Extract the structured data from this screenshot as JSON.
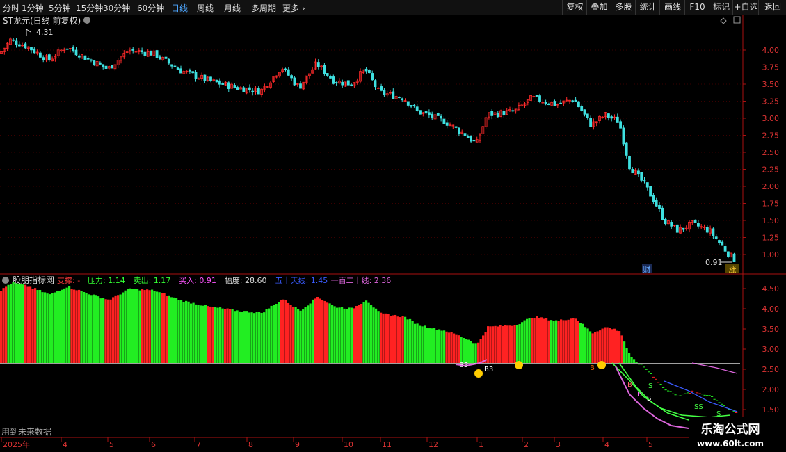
{
  "toolbar": {
    "periods": [
      "分时",
      "1分钟",
      "5分钟",
      "15分钟",
      "30分钟",
      "60分钟",
      "日线",
      "周线",
      "月线",
      "多周期",
      "更多"
    ],
    "active_period": "日线",
    "right_buttons": [
      "复权",
      "叠加",
      "多股",
      "统计",
      "画线",
      "F10",
      "标记",
      "+自选",
      "返回"
    ]
  },
  "main_panel": {
    "title": "ST龙元(日线 前复权)",
    "max_label": "4.31",
    "min_label": "0.91",
    "badge_cai": "财",
    "badge_zhang": "涨",
    "y_ticks": [
      "4.00",
      "3.75",
      "3.50",
      "3.25",
      "3.00",
      "2.75",
      "2.50",
      "2.25",
      "2.00",
      "1.75",
      "1.50",
      "1.25",
      "1.00"
    ]
  },
  "sub_panel": {
    "title": "股朋指标网",
    "readouts": [
      {
        "label": "支撑: -",
        "color": "#ff3b3b"
      },
      {
        "label": "压力: 1.14",
        "color": "#33ff33"
      },
      {
        "label": "卖出: 1.17",
        "color": "#33ff33"
      },
      {
        "label": "买入: 0.91",
        "color": "#ff55ff"
      },
      {
        "label": "幅度: 28.60",
        "color": "#dddddd"
      },
      {
        "label": "五十天线: 1.45",
        "color": "#3a5bff"
      },
      {
        "label": "一百二十线: 2.36",
        "color": "#dd66dd"
      }
    ],
    "y_ticks": [
      "4.50",
      "4.00",
      "3.50",
      "3.00",
      "2.50",
      "2.00",
      "1.50"
    ],
    "markers": [
      "B3",
      "B3",
      "B",
      "B",
      "B",
      "S",
      "SS",
      "S",
      "S"
    ],
    "future_note": "用到未来数据"
  },
  "x_axis": {
    "labels": [
      "2025年",
      "4",
      "5",
      "6",
      "7",
      "8",
      "9",
      "10",
      "11",
      "12",
      "1",
      "2",
      "3",
      "4",
      "5"
    ]
  },
  "watermark": {
    "line1": "乐淘公式网",
    "line2": "www.60lt.com"
  },
  "colors": {
    "up": "#ff2a2a",
    "down": "#3fe0e0",
    "bar_green": "#22ee22",
    "bar_red": "#ff2222",
    "ma50": "#3a5bff",
    "ma120": "#dd66dd",
    "line_green": "#44ff44",
    "axis_red": "#aa1111"
  },
  "chart_data": [
    {
      "type": "line",
      "name_note": "candlestick close series (daily, approx)",
      "x": [
        "2025-03",
        "2025-04",
        "2025-05",
        "2025-06",
        "2025-07",
        "2025-08",
        "2025-09",
        "2025-10",
        "2025-11",
        "2025-12",
        "2026-01",
        "2026-02",
        "2026-03",
        "2026-04",
        "2026-05"
      ],
      "close": [
        4.1,
        3.95,
        4.02,
        3.9,
        3.55,
        3.45,
        3.62,
        3.4,
        3.05,
        2.8,
        3.05,
        3.3,
        3.2,
        2.2,
        1.35
      ],
      "ylim": [
        0.85,
        4.35
      ]
    },
    {
      "type": "bar",
      "x": [
        "2025-03",
        "2025-04",
        "2025-05",
        "2025-06",
        "2025-07",
        "2025-08",
        "2025-09",
        "2025-10",
        "2025-11",
        "2025-12",
        "2026-01",
        "2026-02",
        "2026-03",
        "2026-04",
        "2026-05"
      ],
      "values": [
        4.4,
        4.35,
        4.3,
        4.2,
        4.1,
        4.05,
        4.15,
        4.05,
        3.9,
        3.75,
        3.95,
        4.1,
        4.0,
        3.5,
        3.15
      ],
      "ylim": [
        1.3,
        4.75
      ]
    }
  ]
}
